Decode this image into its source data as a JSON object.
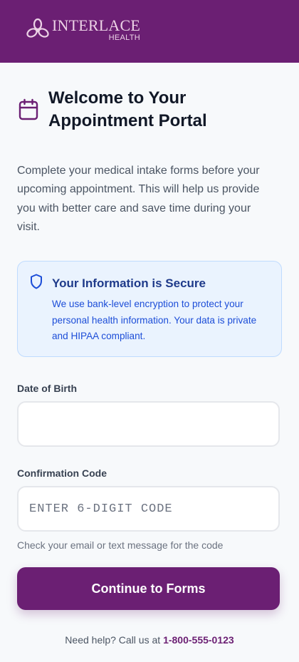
{
  "brand": {
    "name": "INTERLACE",
    "sub": "HEALTH",
    "color": "#6b1f73"
  },
  "page": {
    "title": "Welcome to Your Appointment Portal",
    "intro": "Complete your medical intake forms before your upcoming appointment. This will help us provide you with better care and save time during your visit."
  },
  "secure": {
    "title": "Your Information is Secure",
    "text": "We use bank-level encryption to protect your personal health information. Your data is private and HIPAA compliant."
  },
  "form": {
    "dob_label": "Date of Birth",
    "dob_value": "",
    "code_label": "Confirmation Code",
    "code_placeholder": "ENTER 6-DIGIT CODE",
    "code_help": "Check your email or text message for the code",
    "submit_label": "Continue to Forms"
  },
  "footer": {
    "help_prefix": "Need help? Call us at",
    "phone": "1-800-555-0123"
  },
  "icons": {
    "logo": "interlace-logo-mark",
    "title": "calendar-icon",
    "secure": "shield-icon"
  }
}
